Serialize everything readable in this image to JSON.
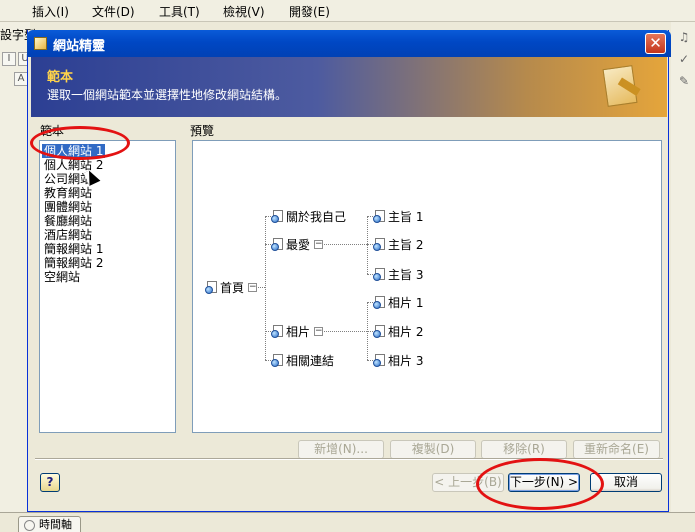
{
  "app": {
    "menu": [
      "插入(I)",
      "文件(D)",
      "工具(T)",
      "檢視(V)",
      "開發(E)"
    ],
    "left_label": "設字型",
    "toolbar_glyphs": [
      "I",
      "U",
      "A"
    ],
    "status_tab": "時間軸"
  },
  "dialog": {
    "title": "網站精靈",
    "close_label": "✕",
    "banner": {
      "title": "範本",
      "subtitle": "選取一個網站範本並選擇性地修改網站結構。"
    },
    "template_label": "範本",
    "preview_label": "預覽",
    "templates": [
      {
        "label": "個人網站 1",
        "selected": true
      },
      {
        "label": "個人網站 2",
        "selected": false
      },
      {
        "label": "公司網站",
        "selected": false
      },
      {
        "label": "教育網站",
        "selected": false
      },
      {
        "label": "團體網站",
        "selected": false
      },
      {
        "label": "餐廳網站",
        "selected": false
      },
      {
        "label": "酒店網站",
        "selected": false
      },
      {
        "label": "簡報網站 1",
        "selected": false
      },
      {
        "label": "簡報網站 2",
        "selected": false
      },
      {
        "label": "空網站",
        "selected": false
      }
    ],
    "tree": {
      "root": "首頁",
      "about": "關於我自己",
      "favorites": "最愛",
      "fav_children": [
        "主旨 1",
        "主旨 2",
        "主旨 3"
      ],
      "photos": "相片",
      "photo_children": [
        "相片 1",
        "相片 2",
        "相片 3"
      ],
      "links": "相關連結"
    },
    "edit_buttons": {
      "add": "新增(N)...",
      "copy": "複製(D)",
      "remove": "移除(R)",
      "rename": "重新命名(E)"
    },
    "nav_buttons": {
      "help": "?",
      "back": "< 上一步(B)",
      "next": "下一步(N) >",
      "cancel": "取消"
    }
  }
}
